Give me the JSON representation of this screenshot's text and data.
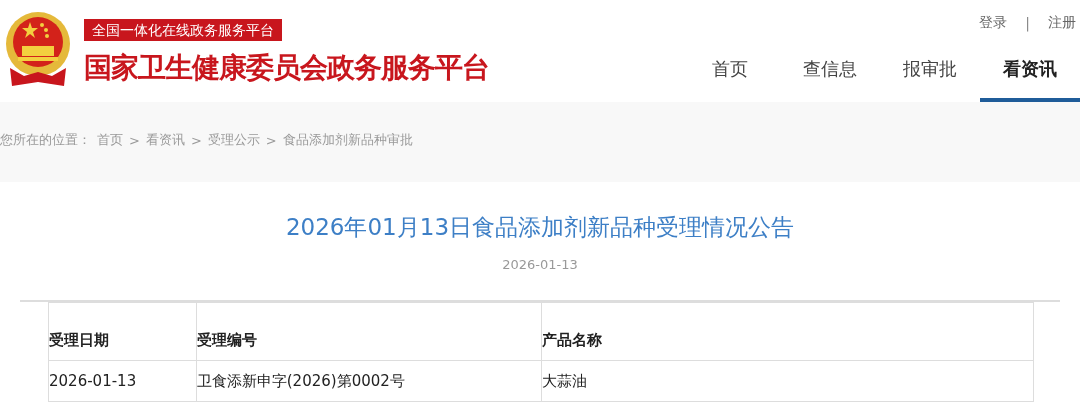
{
  "header": {
    "badge": "全国一体化在线政务服务平台",
    "site_title": "国家卫生健康委员会政务服务平台",
    "user_links": [
      {
        "label": "登录"
      },
      {
        "label": "注册"
      }
    ],
    "user_links_separator": "|",
    "nav": [
      {
        "label": "首页",
        "selected": false
      },
      {
        "label": "查信息",
        "selected": false
      },
      {
        "label": "报审批",
        "selected": false
      },
      {
        "label": "看资讯",
        "selected": true
      }
    ]
  },
  "breadcrumb": {
    "prefix": "您所在的位置：",
    "separator": ">",
    "items": [
      "首页",
      "看资讯",
      "受理公示",
      "食品添加剂新品种审批"
    ]
  },
  "article": {
    "title": "2026年01月13日食品添加剂新品种受理情况公告",
    "date": "2026-01-13"
  },
  "table": {
    "columns": [
      "受理日期",
      "受理编号",
      "产品名称"
    ],
    "rows": [
      [
        "2026-01-13",
        "卫食添新申字(2026)第0002号",
        "大蒜油"
      ]
    ]
  }
}
